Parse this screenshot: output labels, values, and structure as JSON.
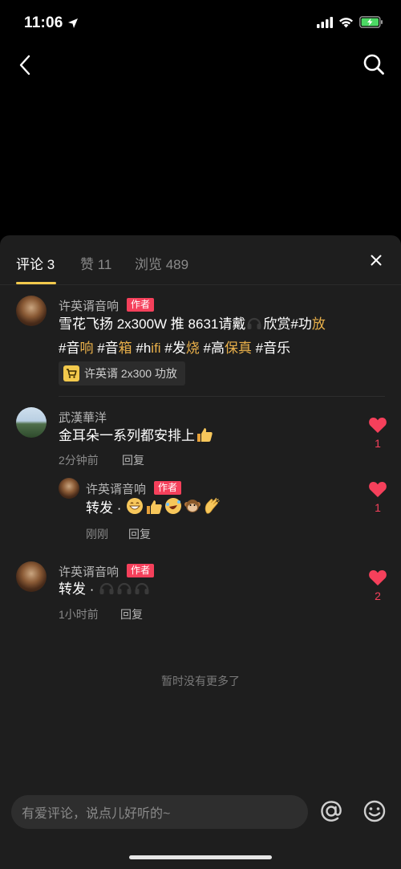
{
  "status": {
    "time": "11:06"
  },
  "tabs": [
    {
      "label": "评论 3"
    },
    {
      "label": "赞 11"
    },
    {
      "label": "浏览 489"
    }
  ],
  "comments": [
    {
      "user": "许英谞音响",
      "badge": "作者",
      "text_parts": [
        "雪花飞扬 2x300W 推 8631请戴",
        "欣赏#功",
        "放",
        "#音",
        "响",
        " #音",
        "箱",
        " #h",
        "ifi",
        " #发",
        "烧",
        " #高",
        "保真",
        " #音乐"
      ],
      "product_label": "许英谞 2x300 功放"
    },
    {
      "user": "武漢華洋",
      "text": "金耳朵一系列都安排上",
      "time": "2分钟前",
      "reply_label": "回复",
      "likes": "1",
      "reply": {
        "user": "许英谞音响",
        "badge": "作者",
        "text": "转发 · ",
        "time": "刚刚",
        "reply_label": "回复",
        "likes": "1"
      }
    },
    {
      "user": "许英谞音响",
      "badge": "作者",
      "text": "转发 · ",
      "time": "1小时前",
      "reply_label": "回复",
      "likes": "2"
    }
  ],
  "no_more": "暂时没有更多了",
  "composer": {
    "placeholder": "有爱评论，说点儿好听的~"
  },
  "colors": {
    "accent": "#f2c94c",
    "like": "#f5405b",
    "hashtag": "#e9b04a",
    "badge": "#f5405b"
  }
}
